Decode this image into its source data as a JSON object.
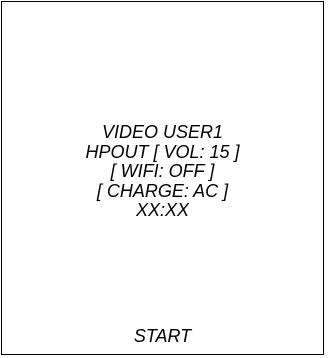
{
  "status": {
    "mode": "VIDEO USER1",
    "output_volume": "HPOUT [ VOL: 15 ]",
    "wifi": "[ WIFI: OFF ]",
    "charge": "[ CHARGE: AC ]",
    "clock": "XX:XX"
  },
  "actions": {
    "start_label": "START"
  },
  "colors": {
    "background": "#ffffff",
    "text": "#000000",
    "border": "#000000"
  }
}
